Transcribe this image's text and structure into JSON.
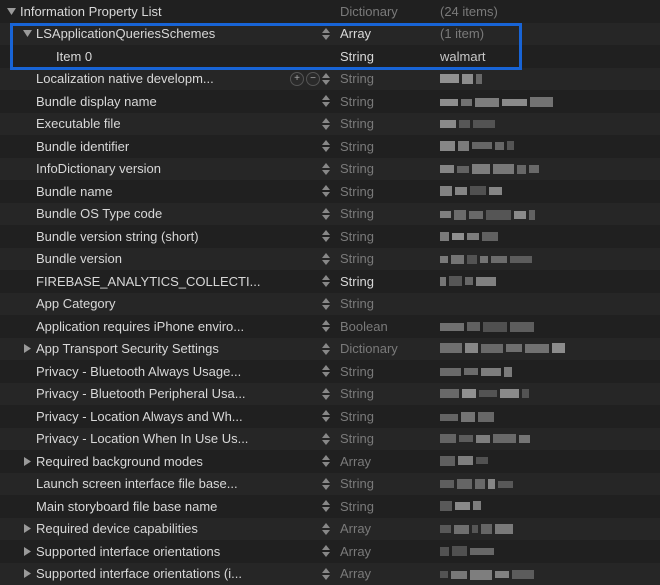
{
  "rows": [
    {
      "key": "Information Property List",
      "type": "Dictionary",
      "value": "(24 items)",
      "indent": 0,
      "disclosure": "down",
      "valueKind": "text",
      "typeStrong": false
    },
    {
      "key": "LSApplicationQueriesSchemes",
      "type": "Array",
      "value": "(1 item)",
      "indent": 1,
      "disclosure": "down",
      "valueKind": "text",
      "typeStrong": true,
      "stepper": true
    },
    {
      "key": "Item 0",
      "type": "String",
      "value": "walmart",
      "indent": 2,
      "disclosure": null,
      "valueKind": "text",
      "typeStrong": true
    },
    {
      "key": "Localization native developm...",
      "type": "String",
      "value": "",
      "indent": 1,
      "disclosure": null,
      "valueKind": "pixel",
      "stepper": true,
      "addremove": true
    },
    {
      "key": "Bundle display name",
      "type": "String",
      "value": "",
      "indent": 1,
      "disclosure": null,
      "valueKind": "pixel",
      "stepper": true
    },
    {
      "key": "Executable file",
      "type": "String",
      "value": "",
      "indent": 1,
      "disclosure": null,
      "valueKind": "pixel",
      "stepper": true
    },
    {
      "key": "Bundle identifier",
      "type": "String",
      "value": "",
      "indent": 1,
      "disclosure": null,
      "valueKind": "pixel",
      "stepper": true
    },
    {
      "key": "InfoDictionary version",
      "type": "String",
      "value": "",
      "indent": 1,
      "disclosure": null,
      "valueKind": "pixel",
      "stepper": true
    },
    {
      "key": "Bundle name",
      "type": "String",
      "value": "",
      "indent": 1,
      "disclosure": null,
      "valueKind": "pixel",
      "stepper": true
    },
    {
      "key": "Bundle OS Type code",
      "type": "String",
      "value": "",
      "indent": 1,
      "disclosure": null,
      "valueKind": "pixel",
      "stepper": true
    },
    {
      "key": "Bundle version string (short)",
      "type": "String",
      "value": "",
      "indent": 1,
      "disclosure": null,
      "valueKind": "pixel",
      "stepper": true
    },
    {
      "key": "Bundle version",
      "type": "String",
      "value": "",
      "indent": 1,
      "disclosure": null,
      "valueKind": "pixel",
      "stepper": true
    },
    {
      "key": "FIREBASE_ANALYTICS_COLLECTI...",
      "type": "String",
      "value": "",
      "indent": 1,
      "disclosure": null,
      "valueKind": "pixel",
      "stepper": true,
      "typeStrong": true
    },
    {
      "key": "App Category",
      "type": "String",
      "value": "",
      "indent": 1,
      "disclosure": null,
      "valueKind": "empty",
      "stepper": true
    },
    {
      "key": "Application requires iPhone enviro...",
      "type": "Boolean",
      "value": "",
      "indent": 1,
      "disclosure": null,
      "valueKind": "pixel",
      "stepper": true
    },
    {
      "key": "App Transport Security Settings",
      "type": "Dictionary",
      "value": "",
      "indent": 1,
      "disclosure": "right",
      "valueKind": "pixel",
      "stepper": true
    },
    {
      "key": "Privacy - Bluetooth Always Usage...",
      "type": "String",
      "value": "",
      "indent": 1,
      "disclosure": null,
      "valueKind": "pixel",
      "stepper": true
    },
    {
      "key": "Privacy - Bluetooth Peripheral Usa...",
      "type": "String",
      "value": "",
      "indent": 1,
      "disclosure": null,
      "valueKind": "pixel",
      "stepper": true
    },
    {
      "key": "Privacy - Location Always and Wh...",
      "type": "String",
      "value": "",
      "indent": 1,
      "disclosure": null,
      "valueKind": "pixel",
      "stepper": true
    },
    {
      "key": "Privacy - Location When In Use Us...",
      "type": "String",
      "value": "",
      "indent": 1,
      "disclosure": null,
      "valueKind": "pixel",
      "stepper": true
    },
    {
      "key": "Required background modes",
      "type": "Array",
      "value": "",
      "indent": 1,
      "disclosure": "right",
      "valueKind": "pixel",
      "stepper": true
    },
    {
      "key": "Launch screen interface file base...",
      "type": "String",
      "value": "",
      "indent": 1,
      "disclosure": null,
      "valueKind": "pixel",
      "stepper": true
    },
    {
      "key": "Main storyboard file base name",
      "type": "String",
      "value": "",
      "indent": 1,
      "disclosure": null,
      "valueKind": "pixel",
      "stepper": true
    },
    {
      "key": "Required device capabilities",
      "type": "Array",
      "value": "",
      "indent": 1,
      "disclosure": "right",
      "valueKind": "pixel",
      "stepper": true
    },
    {
      "key": "Supported interface orientations",
      "type": "Array",
      "value": "",
      "indent": 1,
      "disclosure": "right",
      "valueKind": "pixel",
      "stepper": true
    },
    {
      "key": "Supported interface orientations (i...",
      "type": "Array",
      "value": "",
      "indent": 1,
      "disclosure": "right",
      "valueKind": "pixel",
      "stepper": true
    }
  ]
}
